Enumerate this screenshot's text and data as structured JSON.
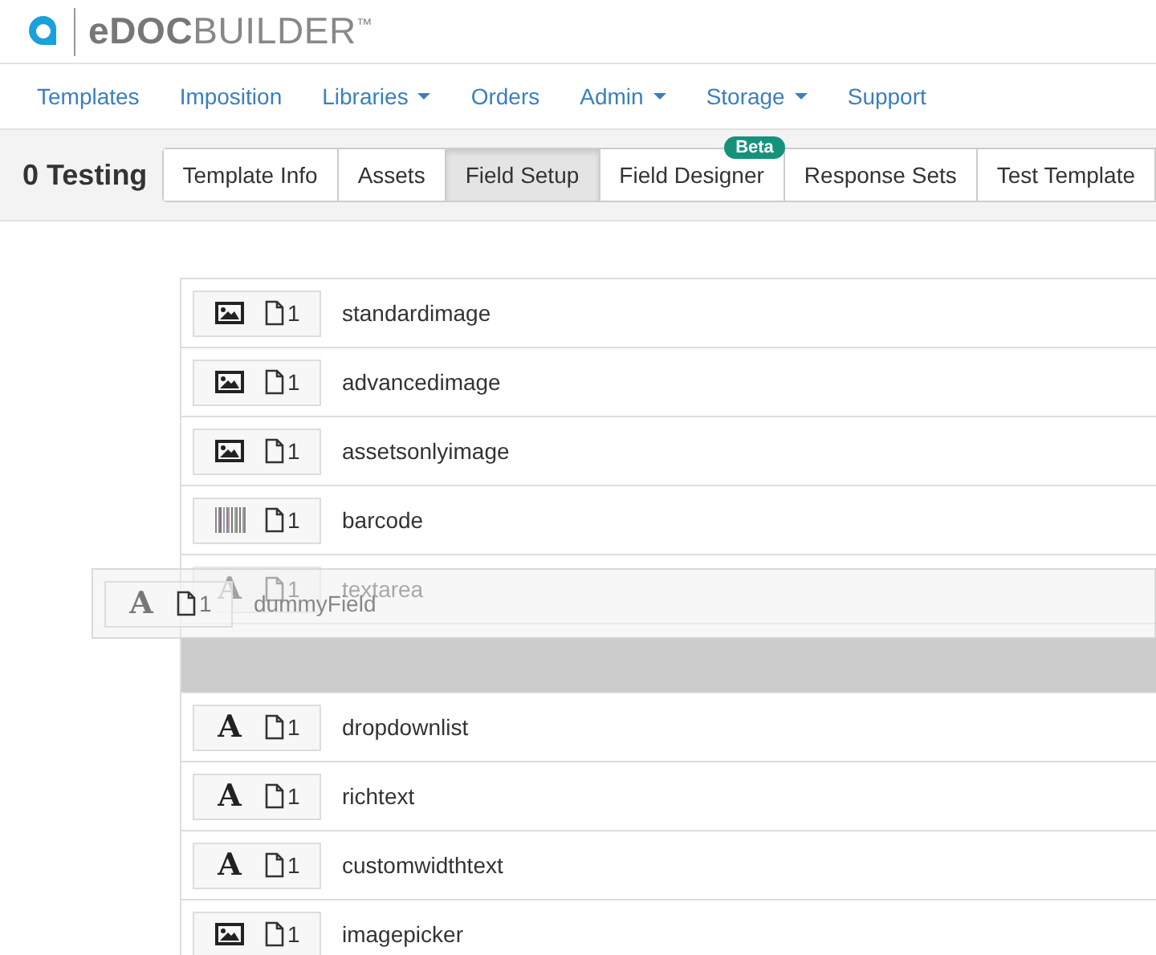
{
  "logo": {
    "text": "**eDOC**BUILDER$^{™}$"
  },
  "nav": [
    {
      "label": "Templates",
      "dropdown": false
    },
    {
      "label": "Imposition",
      "dropdown": false
    },
    {
      "label": "Libraries",
      "dropdown": true
    },
    {
      "label": "Orders",
      "dropdown": false
    },
    {
      "label": "Admin",
      "dropdown": true
    },
    {
      "label": "Storage",
      "dropdown": true
    },
    {
      "label": "Support",
      "dropdown": false
    }
  ],
  "page_title": "0 Testing",
  "tabs": [
    {
      "label": "Template Info",
      "selected": false
    },
    {
      "label": "Assets",
      "selected": false
    },
    {
      "label": "Field Setup",
      "selected": true
    },
    {
      "label": "Field Designer",
      "selected": false,
      "badge": "Beta"
    },
    {
      "label": "Response Sets",
      "selected": false
    },
    {
      "label": "Test Template",
      "selected": false
    }
  ],
  "fields": [
    {
      "kind": "image",
      "name": "standardimage",
      "pages": "1",
      "dimmed": false
    },
    {
      "kind": "image",
      "name": "advancedimage",
      "pages": "1",
      "dimmed": false
    },
    {
      "kind": "image",
      "name": "assetsonlyimage",
      "pages": "1",
      "dimmed": false
    },
    {
      "kind": "barcode",
      "name": "barcode",
      "pages": "1",
      "dimmed": false
    },
    {
      "kind": "text",
      "glyph": "A",
      "name": "textarea",
      "pages": "1",
      "dimmed": true
    },
    {
      "kind": "drop-placeholder"
    },
    {
      "kind": "text",
      "glyph": "A",
      "name": "dropdownlist",
      "pages": "1",
      "dimmed": false
    },
    {
      "kind": "text",
      "glyph": "A",
      "name": "richtext",
      "pages": "1",
      "dimmed": false
    },
    {
      "kind": "text",
      "glyph": "A",
      "name": "customwidthtext",
      "pages": "1",
      "dimmed": false
    },
    {
      "kind": "image",
      "name": "imagepicker",
      "pages": "1",
      "dimmed": false
    }
  ],
  "dragged_field": {
    "kind": "text",
    "glyph": "A",
    "name": "dummyField",
    "pages": "1"
  }
}
